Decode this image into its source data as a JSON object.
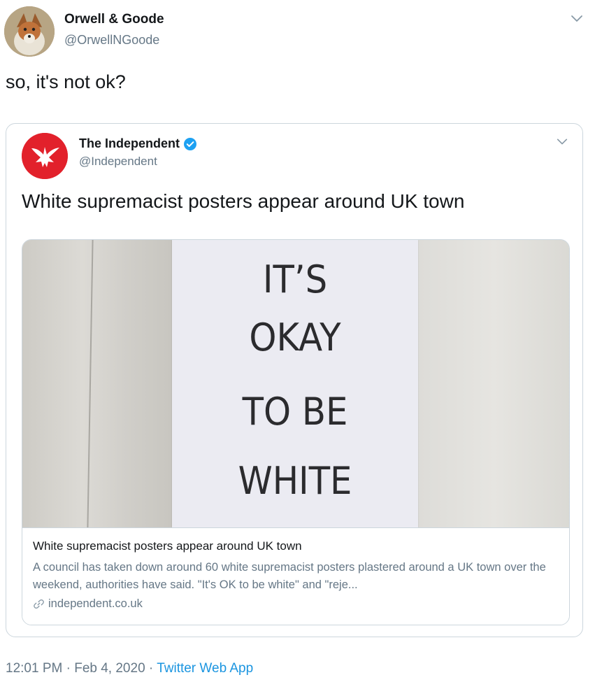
{
  "tweet": {
    "author_name": "Orwell & Goode",
    "author_handle": "@OrwellNGoode",
    "text": "so, it's not ok?",
    "timestamp": "12:01 PM",
    "separator": " · ",
    "date": "Feb 4, 2020",
    "source_app": "Twitter Web App",
    "avatar_icon": "fox-avatar-icon",
    "menu_icon": "chevron-down-icon"
  },
  "quoted": {
    "author_name": "The Independent",
    "author_handle": "@Independent",
    "verified_icon": "verified-badge-icon",
    "text": "White supremacist posters appear around UK town",
    "card": {
      "poster_lines": [
        "IT’S",
        "OKAY",
        "TO BE",
        "WHITE"
      ],
      "title": "White supremacist posters appear around UK town",
      "description": "A council has taken down around 60 white supremacist posters plastered around a UK town over the weekend, authorities have said.  \"It's OK to be white\" and \"reje...",
      "domain": "independent.co.uk",
      "link_icon": "link-icon"
    }
  },
  "colors": {
    "link_blue": "#1b95e0",
    "secondary_text": "#657786",
    "border": "#ccd6dd",
    "independent_red": "#e2212b",
    "verified_blue": "#1da1f2"
  }
}
